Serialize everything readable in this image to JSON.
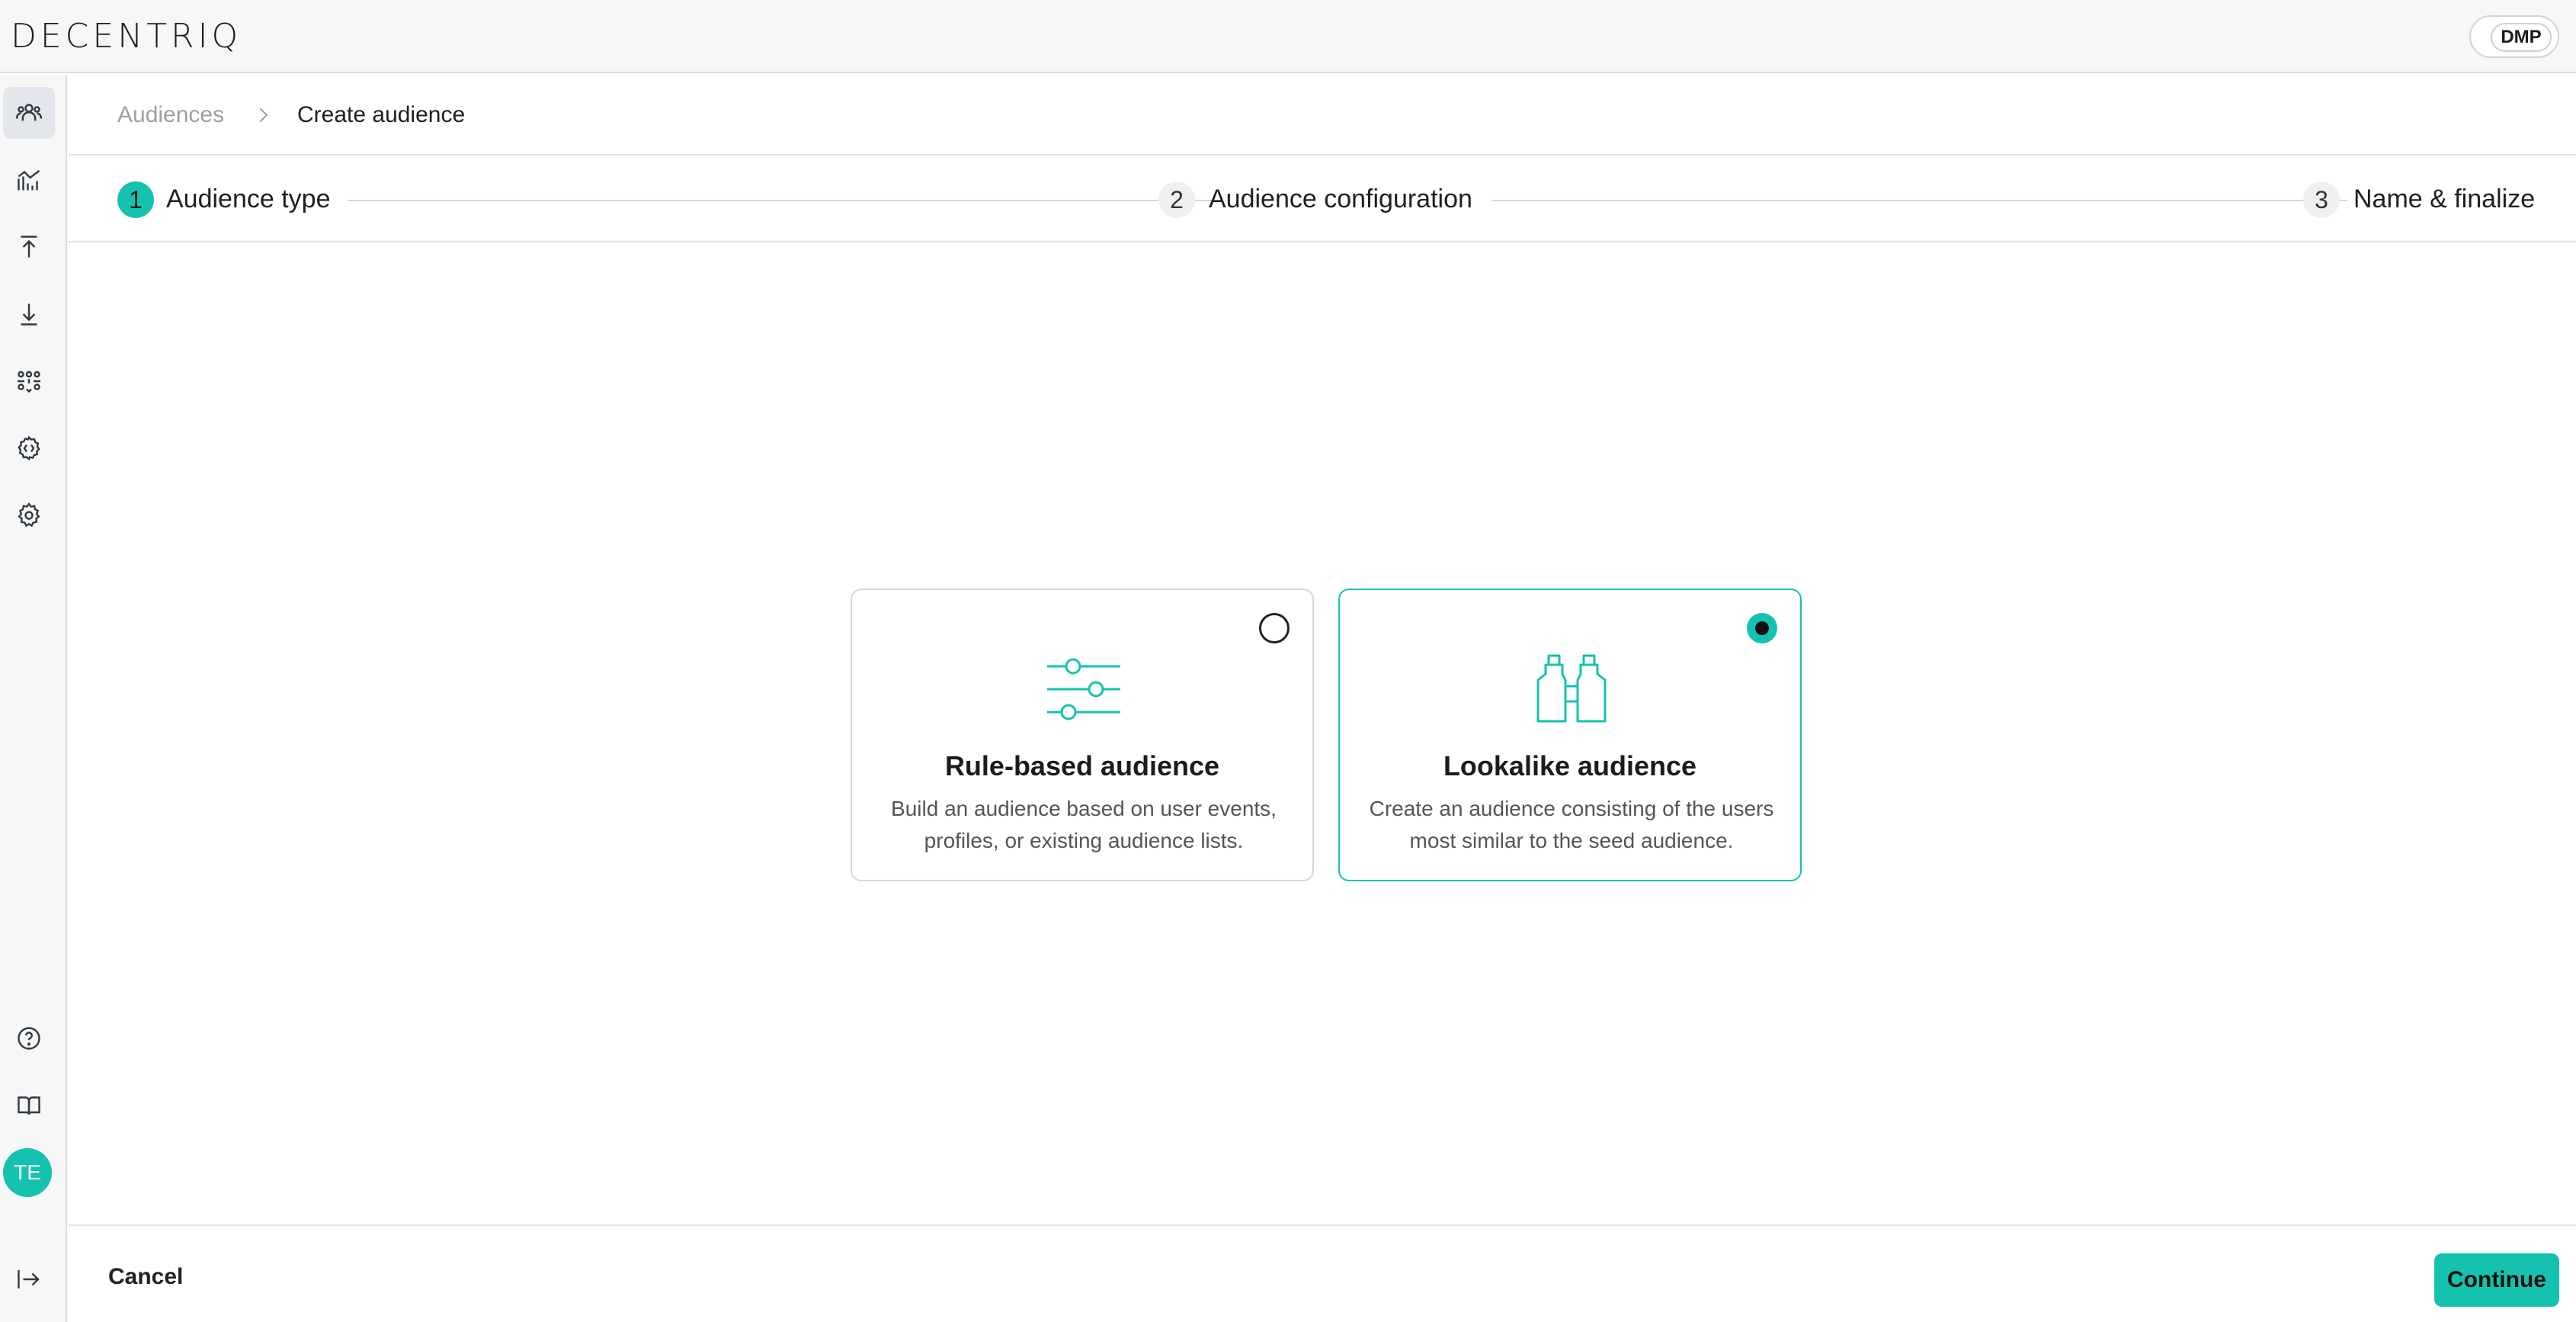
{
  "app": {
    "logo": "DECENTRIQ",
    "org_badge": "DMP"
  },
  "sidebar": {
    "items": [
      {
        "icon": "audiences-icon",
        "active": true
      },
      {
        "icon": "insights-chart-icon",
        "active": false
      },
      {
        "icon": "upload-icon",
        "active": false
      },
      {
        "icon": "download-icon",
        "active": false
      },
      {
        "icon": "collaboration-icon",
        "active": false
      },
      {
        "icon": "developer-settings-icon",
        "active": false
      },
      {
        "icon": "settings-icon",
        "active": false
      }
    ],
    "bottom": [
      "help-icon",
      "docs-book-icon"
    ],
    "avatar_initials": "TE",
    "logout_icon": "logout-icon"
  },
  "breadcrumb": {
    "root": "Audiences",
    "current": "Create audience"
  },
  "stepper": {
    "steps": [
      {
        "number": "1",
        "label": "Audience type",
        "active": true
      },
      {
        "number": "2",
        "label": "Audience configuration",
        "active": false
      },
      {
        "number": "3",
        "label": "Name & finalize",
        "active": false
      }
    ]
  },
  "cards": [
    {
      "title": "Rule-based audience",
      "description": "Build an audience based on user events, profiles, or existing audience lists.",
      "selected": false,
      "icon": "sliders-icon"
    },
    {
      "title": "Lookalike audience",
      "description": "Create an audience consisting of the users most similar to the seed audience.",
      "selected": true,
      "icon": "binoculars-icon"
    }
  ],
  "footer": {
    "cancel_label": "Cancel",
    "continue_label": "Continue"
  },
  "colors": {
    "accent": "#15c2b0",
    "border": "#d6d6d6",
    "sidebar_bg": "#f7f7f7"
  }
}
